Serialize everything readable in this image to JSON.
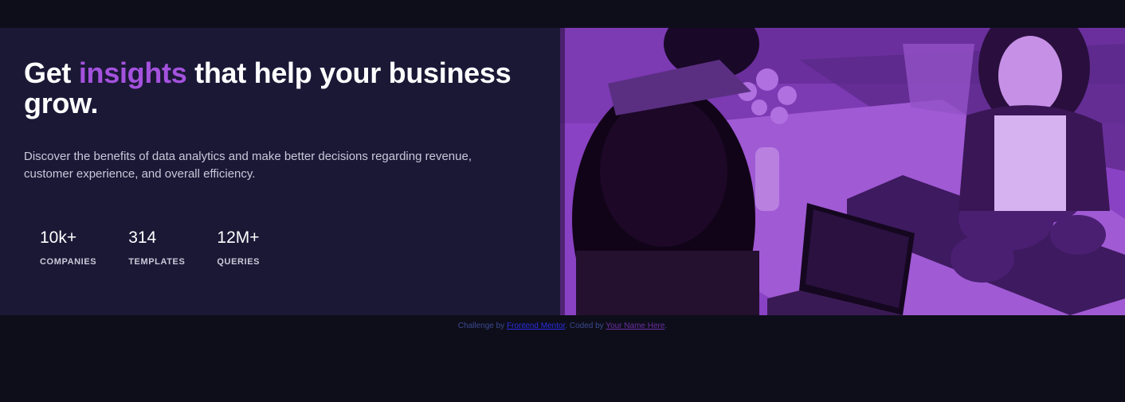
{
  "hero": {
    "headline_before": "Get",
    "headline_accent": "insights",
    "headline_after": "that help your business grow.",
    "description": "Discover the benefits of data analytics and make better decisions regarding revenue, customer experience, and overall efficiency."
  },
  "stats": [
    {
      "value": "10k+",
      "label": "COMPANIES"
    },
    {
      "value": "314",
      "label": "TEMPLATES"
    },
    {
      "value": "12M+",
      "label": "QUERIES"
    }
  ],
  "attribution": {
    "prefix": "Challenge by",
    "link1": "Frontend Mentor",
    "middle": ". Coded by",
    "link2": "Your Name Here",
    "suffix": "."
  },
  "colors": {
    "page_background": "#0e0e1a",
    "card_background": "#1b1836",
    "accent": "#a452de",
    "image_overlay": "#8a42c4"
  }
}
